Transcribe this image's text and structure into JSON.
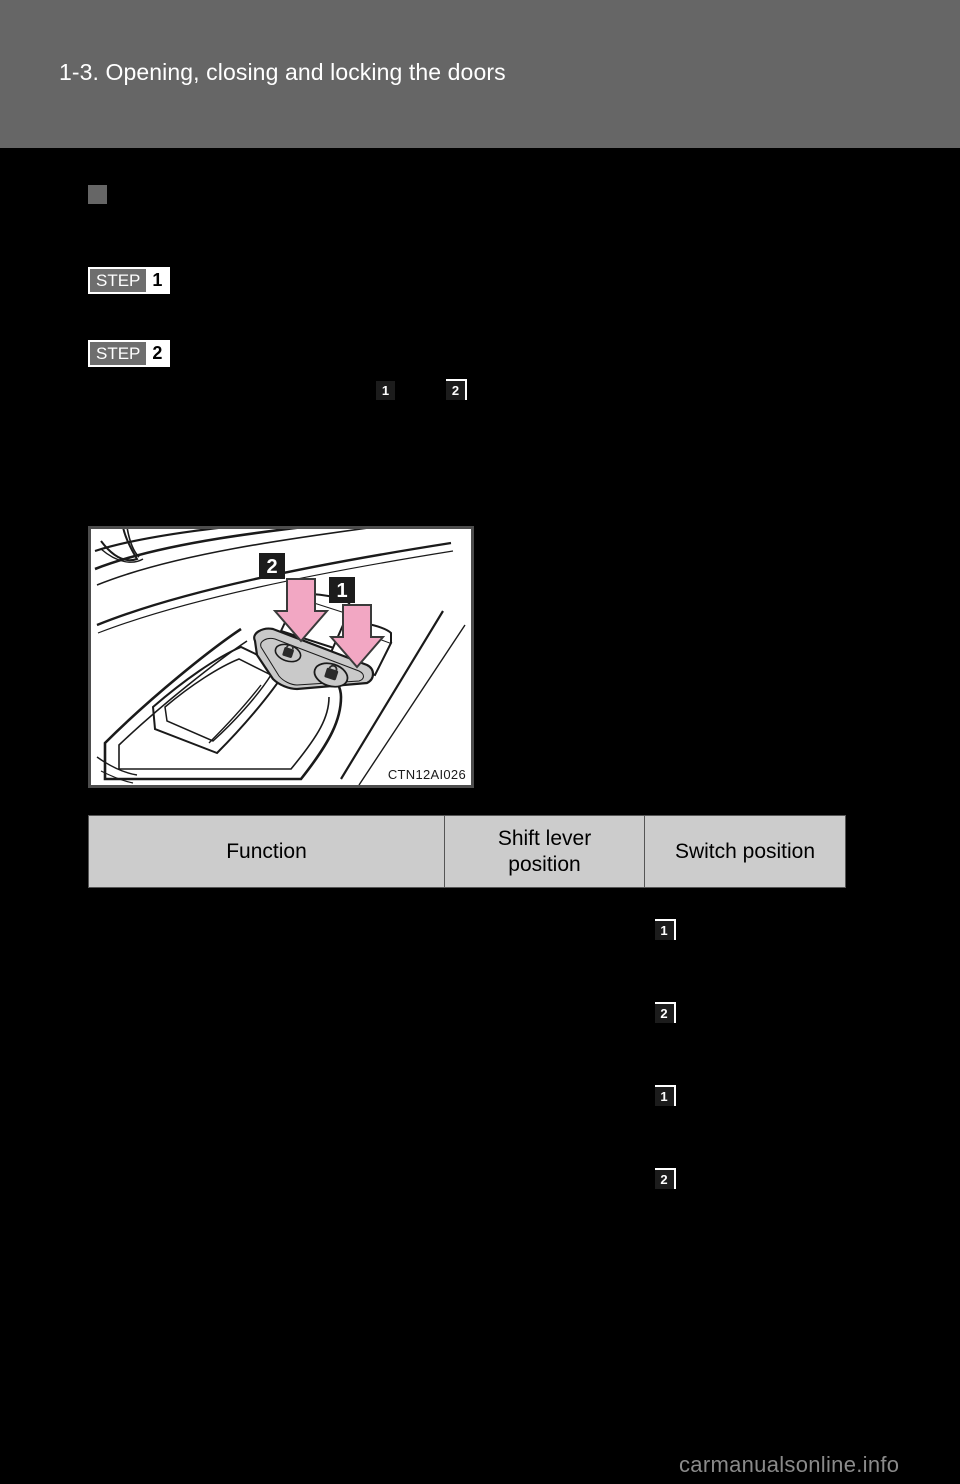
{
  "page": {
    "header_title": "1-3. Opening, closing and locking the doors",
    "background_color": "#000000",
    "header_band_color": "#666666",
    "watermark": "carmanualsonline.info"
  },
  "section": {
    "bullet_icon": "square-bullet-icon",
    "heading": ""
  },
  "steps": [
    {
      "word": "STEP",
      "number": "1",
      "body": ""
    },
    {
      "word": "STEP",
      "number": "2",
      "body": ""
    }
  ],
  "inline_badges": [
    {
      "number": "1",
      "style": "solid"
    },
    {
      "number": "2",
      "style": "bordered"
    }
  ],
  "figure": {
    "caption": "CTN12AI026",
    "alt_name": "door-lock-switch-illustration",
    "callouts": [
      {
        "number": "2",
        "target": "lock-button"
      },
      {
        "number": "1",
        "target": "unlock-button"
      }
    ],
    "arrow_color": "#f0a0bc",
    "panel_color": "#c9c9c9"
  },
  "table": {
    "headers": [
      "Function",
      "Shift lever\nposition",
      "Switch position"
    ],
    "header_function": "Function",
    "header_shift_lever_line1": "Shift lever",
    "header_shift_lever_line2": "position",
    "header_switch_position": "Switch position",
    "rows": [
      {
        "function": "",
        "shift_lever": "",
        "switch_number": "1"
      },
      {
        "function": "",
        "shift_lever": "",
        "switch_number": "2"
      },
      {
        "function": "",
        "shift_lever": "",
        "switch_number": "1"
      },
      {
        "function": "",
        "shift_lever": "",
        "switch_number": "2"
      }
    ]
  }
}
